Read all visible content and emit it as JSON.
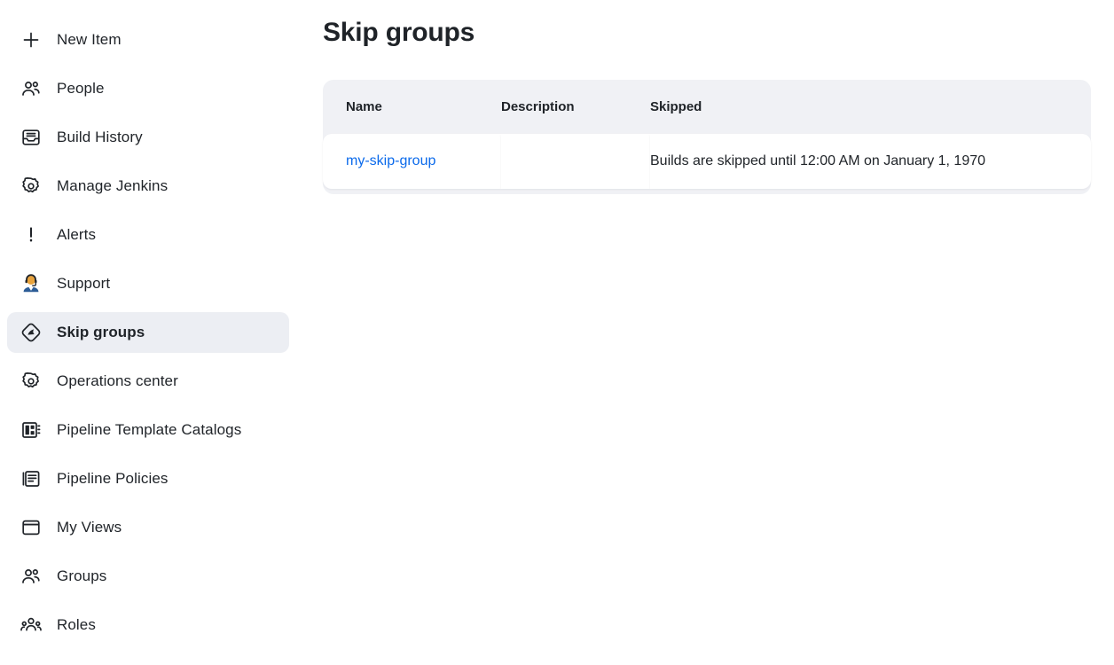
{
  "sidebar": {
    "items": [
      {
        "label": "New Item",
        "icon": "plus-icon",
        "active": false
      },
      {
        "label": "People",
        "icon": "people-icon",
        "active": false
      },
      {
        "label": "Build History",
        "icon": "inbox-tray-icon",
        "active": false
      },
      {
        "label": "Manage Jenkins",
        "icon": "gear-icon",
        "active": false
      },
      {
        "label": "Alerts",
        "icon": "exclamation-icon",
        "active": false
      },
      {
        "label": "Support",
        "icon": "support-agent-icon",
        "active": false
      },
      {
        "label": "Skip groups",
        "icon": "skip-diamond-icon",
        "active": true
      },
      {
        "label": "Operations center",
        "icon": "gear-icon",
        "active": false
      },
      {
        "label": "Pipeline Template Catalogs",
        "icon": "dashboard-grid-icon",
        "active": false
      },
      {
        "label": "Pipeline Policies",
        "icon": "documents-icon",
        "active": false
      },
      {
        "label": "My Views",
        "icon": "window-icon",
        "active": false
      },
      {
        "label": "Groups",
        "icon": "people-icon",
        "active": false
      },
      {
        "label": "Roles",
        "icon": "people-group-icon",
        "active": false
      }
    ]
  },
  "main": {
    "title": "Skip groups",
    "table": {
      "columns": [
        "Name",
        "Description",
        "Skipped"
      ],
      "rows": [
        {
          "name": "my-skip-group",
          "description": "",
          "skipped": "Builds are skipped until 12:00 AM on January 1, 1970"
        }
      ]
    }
  },
  "colors": {
    "link": "#0b6aeb",
    "text": "#1f2328",
    "active_item_bg": "#eceef3",
    "table_header_bg": "#f0f1f5",
    "row_bg": "#ffffff"
  }
}
